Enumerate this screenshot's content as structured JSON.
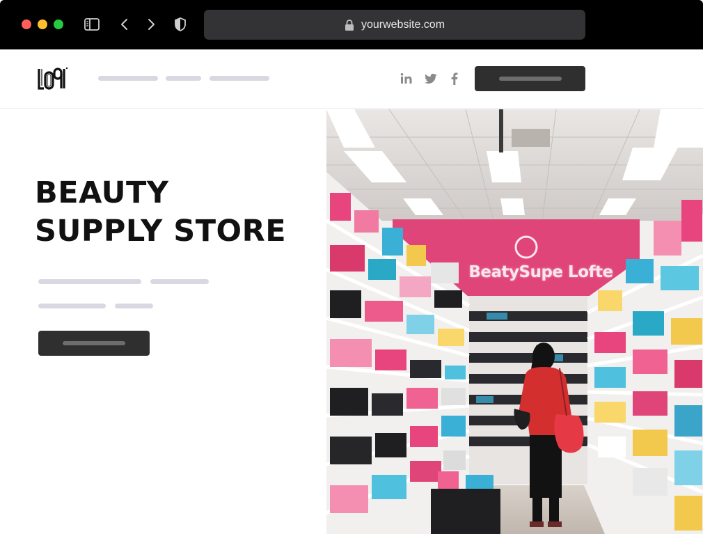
{
  "browser": {
    "url": "yourwebsite.com"
  },
  "icons": {
    "sidebar": "sidebar-icon",
    "back": "chevron-left-icon",
    "forward": "chevron-right-icon",
    "shield": "shield-icon",
    "lock": "lock-icon",
    "logo": "logo-icon",
    "social": [
      "linkedin-icon",
      "twitter-icon",
      "facebook-icon"
    ]
  },
  "hero": {
    "title_line1": "BEAUTY",
    "title_line2": "SUPPLY STORE"
  },
  "store_photo": {
    "sign_text": "BeatySupe Lofte"
  },
  "colors": {
    "chrome_bg": "#000000",
    "url_bar": "#333335",
    "button": "#2f2f30",
    "placeholder": "#d8d8e2",
    "traffic_red": "#ff5f57",
    "traffic_yellow": "#febc2e",
    "traffic_green": "#28c840",
    "store_wall": "#e0457a"
  }
}
